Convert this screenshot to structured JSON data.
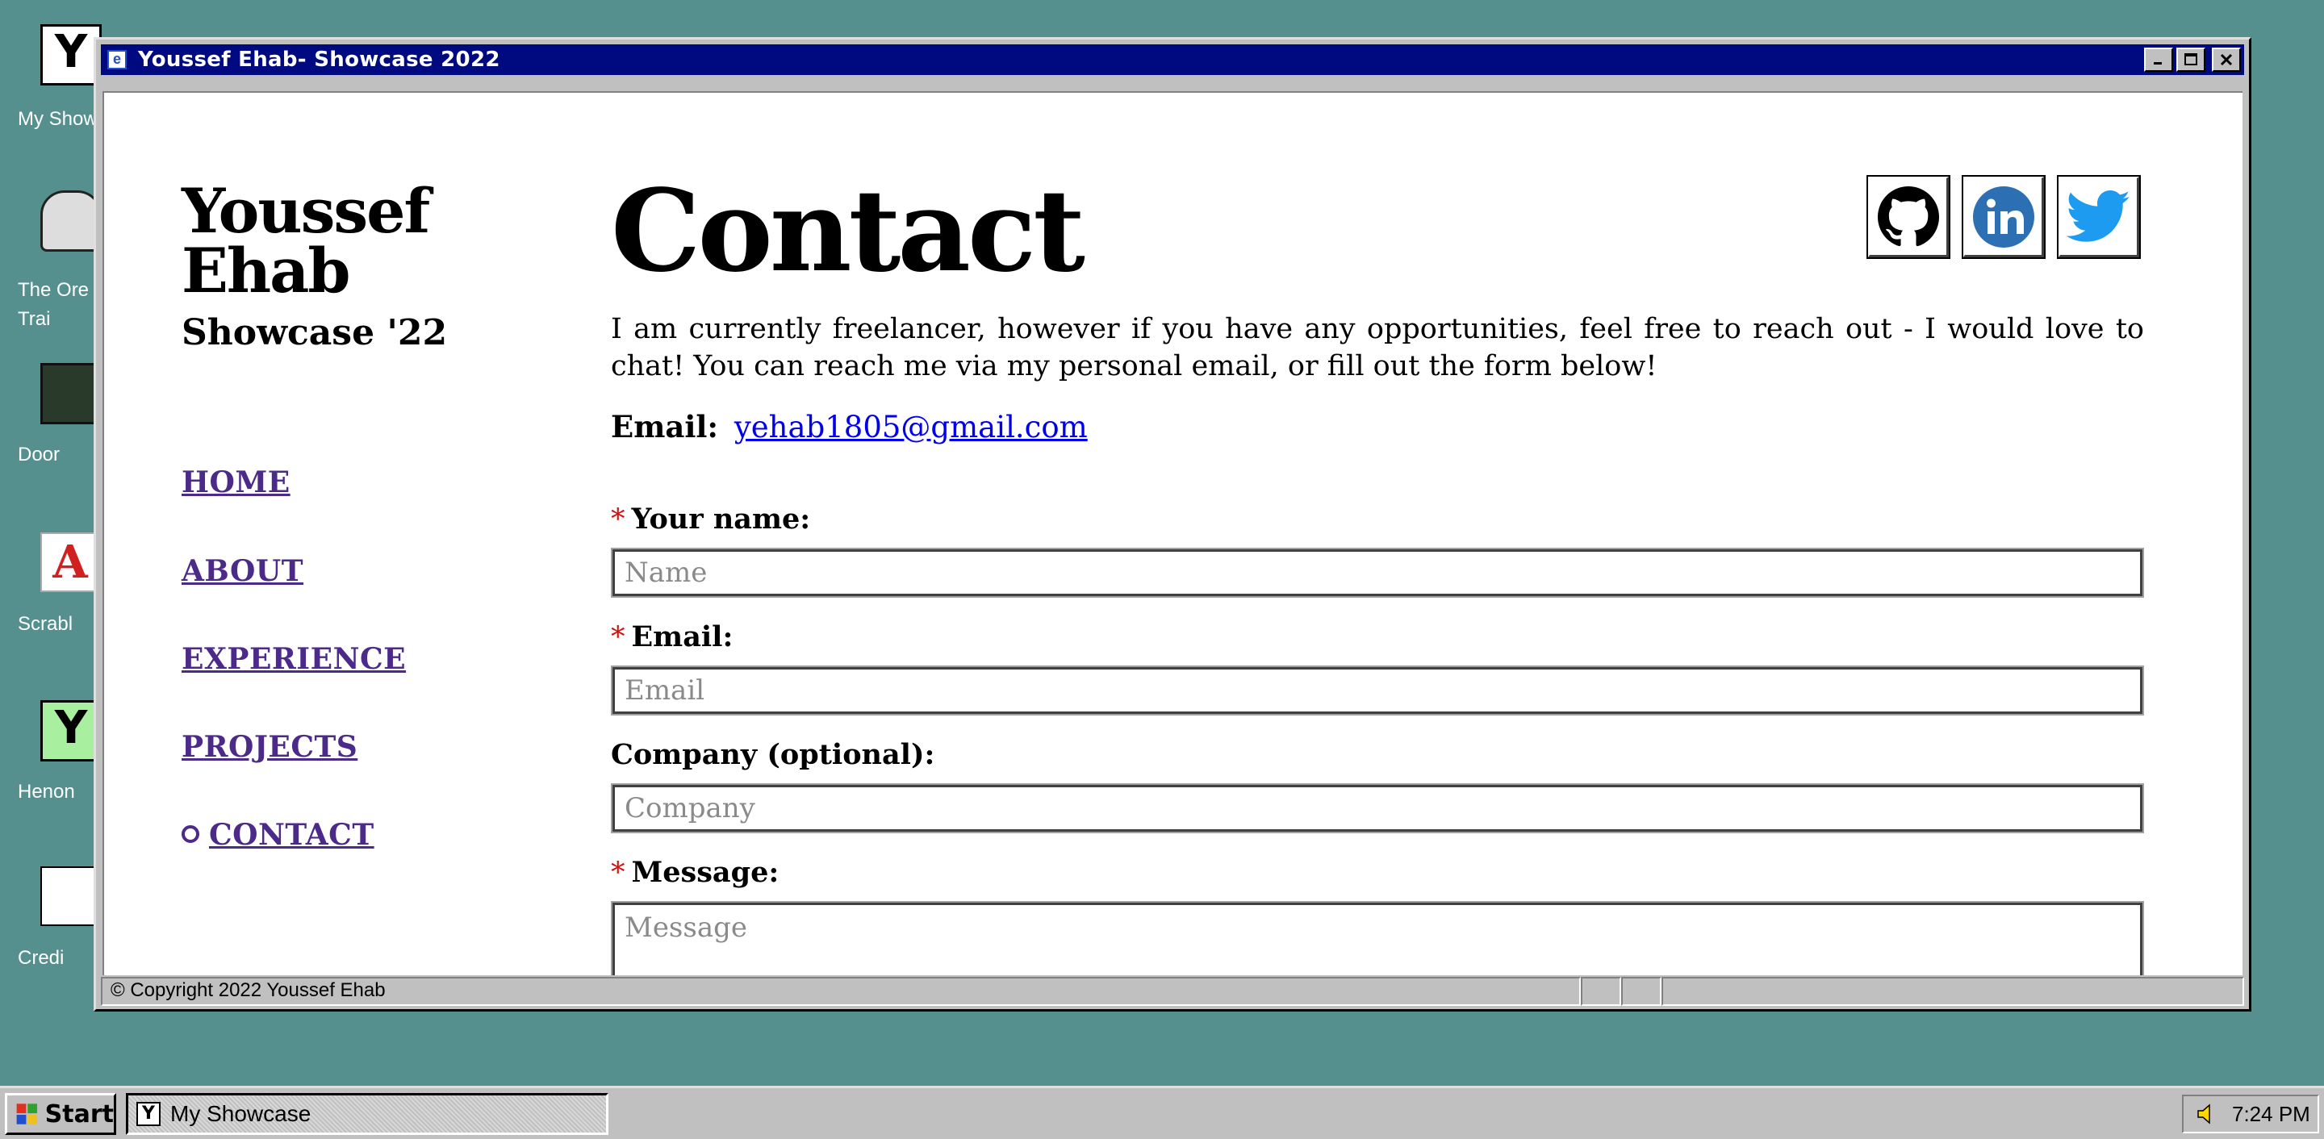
{
  "desktop": {
    "icons": [
      {
        "label": "My Show",
        "glyph": "Y"
      },
      {
        "label": "The Ore\nTrai",
        "glyph": ""
      },
      {
        "label": "Door",
        "glyph": ""
      },
      {
        "label": "Scrabl",
        "glyph": "A"
      },
      {
        "label": "Henon",
        "glyph": "Y"
      },
      {
        "label": "Credi",
        "glyph": ""
      }
    ]
  },
  "window": {
    "title": "Youssef Ehab- Showcase 2022",
    "title_icon": "browser-icon",
    "controls": [
      "minimize",
      "maximize",
      "close"
    ]
  },
  "sidebar": {
    "name_line1": "Youssef",
    "name_line2": "Ehab",
    "subtitle": "Showcase '22",
    "nav": [
      {
        "label": "HOME",
        "active": false
      },
      {
        "label": "ABOUT",
        "active": false
      },
      {
        "label": "EXPERIENCE",
        "active": false
      },
      {
        "label": "PROJECTS",
        "active": false
      },
      {
        "label": "CONTACT",
        "active": true
      }
    ]
  },
  "main": {
    "heading": "Contact",
    "social": [
      "github-icon",
      "linkedin-icon",
      "twitter-icon"
    ],
    "intro": "I am currently freelancer, however if you have any opportunities, feel free to reach out - I would love to chat! You can reach me via my personal email, or fill out the form below!",
    "email_label": "Email:",
    "email_value": "yehab1805@gmail.com",
    "form": {
      "name_label": "Your name:",
      "name_placeholder": "Name",
      "email_label": "Email:",
      "email_placeholder": "Email",
      "company_label": "Company (optional):",
      "company_placeholder": "Company",
      "message_label": "Message:",
      "message_placeholder": "Message",
      "required_mark": "*"
    }
  },
  "statusbar": {
    "copyright": "© Copyright 2022 Youssef Ehab"
  },
  "taskbar": {
    "start_label": "Start",
    "task_label": "My Showcase",
    "time": "7:24 PM"
  }
}
